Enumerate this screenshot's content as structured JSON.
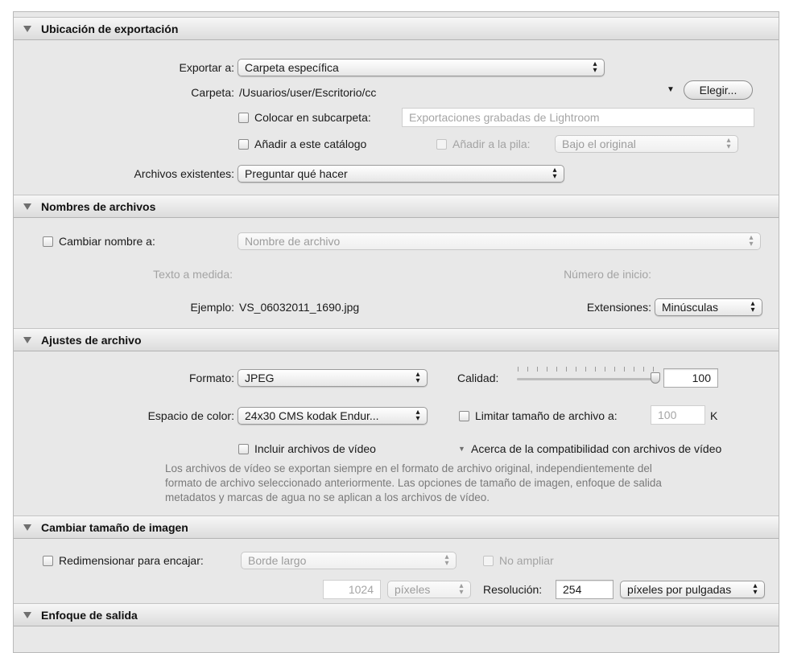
{
  "export_location": {
    "header": "Ubicación de exportación",
    "export_to_label": "Exportar a:",
    "export_to_value": "Carpeta específica",
    "folder_label": "Carpeta:",
    "folder_path": "/Usuarios/user/Escritorio/cc",
    "choose_button": "Elegir...",
    "subfolder_label": "Colocar en subcarpeta:",
    "subfolder_placeholder": "Exportaciones grabadas de Lightroom",
    "add_catalog_label": "Añadir a este catálogo",
    "add_stack_label": "Añadir a la pila:",
    "stack_value": "Bajo el original",
    "existing_files_label": "Archivos existentes:",
    "existing_files_value": "Preguntar qué hacer"
  },
  "file_naming": {
    "header": "Nombres de archivos",
    "rename_label": "Cambiar nombre a:",
    "rename_value": "Nombre de archivo",
    "custom_text_label": "Texto a medida:",
    "start_number_label": "Número de inicio:",
    "example_label": "Ejemplo:",
    "example_value": "VS_06032011_1690.jpg",
    "extensions_label": "Extensiones:",
    "extensions_value": "Minúsculas"
  },
  "file_settings": {
    "header": "Ajustes de archivo",
    "format_label": "Formato:",
    "format_value": "JPEG",
    "quality_label": "Calidad:",
    "quality_value": "100",
    "color_space_label": "Espacio de color:",
    "color_space_value": "24x30 CMS kodak Endur...",
    "limit_size_label": "Limitar tamaño de archivo a:",
    "limit_size_value": "100",
    "limit_size_unit": "K",
    "include_video_label": "Incluir archivos de vídeo",
    "video_compat_label": "Acerca de la compatibilidad con archivos de vídeo",
    "video_note": [
      "Los archivos de vídeo se exportan siempre en el formato de archivo original, independientemente del",
      "formato de archivo seleccionado anteriormente. Las opciones de tamaño de imagen, enfoque de salida",
      "metadatos y marcas de agua no se aplican a los archivos de vídeo."
    ]
  },
  "image_sizing": {
    "header": "Cambiar tamaño de imagen",
    "resize_label": "Redimensionar para encajar:",
    "resize_value": "Borde largo",
    "no_enlarge_label": "No ampliar",
    "size_value": "1024",
    "size_unit": "píxeles",
    "resolution_label": "Resolución:",
    "resolution_value": "254",
    "resolution_unit": "píxeles por pulgadas"
  },
  "output_sharpening": {
    "header": "Enfoque de salida"
  }
}
